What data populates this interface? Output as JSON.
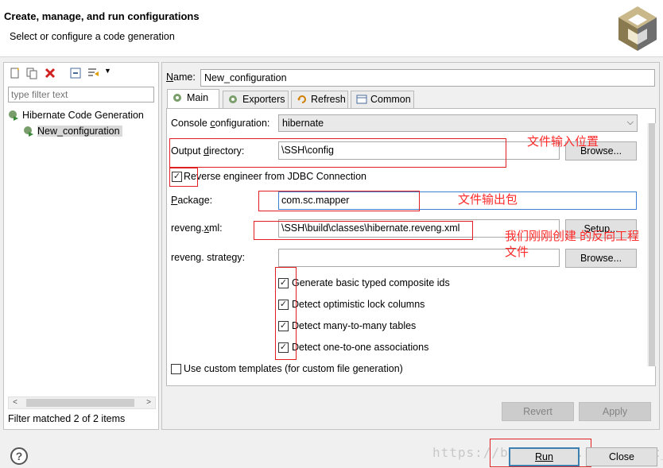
{
  "header": {
    "title": "Create, manage, and run configurations",
    "subtitle": "Select or configure a code generation"
  },
  "left": {
    "filter_placeholder": "type filter text",
    "tree": {
      "root_label": "Hibernate Code Generation",
      "child_label": "New_configuration"
    },
    "status": "Filter matched 2 of 2 items"
  },
  "right": {
    "name_label": "Name:",
    "name_value": "New_configuration",
    "tabs": [
      {
        "label": "Main",
        "icon": "main-config-icon"
      },
      {
        "label": "Exporters",
        "icon": "exporters-icon"
      },
      {
        "label": "Refresh",
        "icon": "refresh-icon"
      },
      {
        "label": "Common",
        "icon": "common-icon"
      }
    ],
    "console_config_label": "Console configuration:",
    "console_config_value": "hibernate",
    "output_dir_label": "Output directory:",
    "output_dir_value": "\\SSH\\config",
    "browse_label": "Browse...",
    "reverse_engineer_label": "Reverse engineer from JDBC Connection",
    "package_label": "Package:",
    "package_value": "com.sc.mapper",
    "reveng_xml_label": "reveng.xml:",
    "reveng_xml_value": "\\SSH\\build\\classes\\hibernate.reveng.xml",
    "setup_label": "Setup...",
    "reveng_strategy_label": "reveng. strategy:",
    "reveng_strategy_value": "",
    "checkbox_composite": "Generate basic typed composite ids",
    "checkbox_optimistic": "Detect optimistic lock columns",
    "checkbox_many": "Detect many-to-many tables",
    "checkbox_one": "Detect one-to-one associations",
    "checkbox_templates": "Use custom templates (for custom file generation)",
    "revert_label": "Revert",
    "apply_label": "Apply"
  },
  "annotations": {
    "output": "文件输入位置",
    "package": "文件输出包",
    "reveng_line1": "我们刚刚创建 的反向工程",
    "reveng_line2": "文件"
  },
  "footer": {
    "help": "?",
    "run_label": "Run",
    "close_label": "Close",
    "watermark": "https://blog.csdn.net/wsnsc_"
  }
}
